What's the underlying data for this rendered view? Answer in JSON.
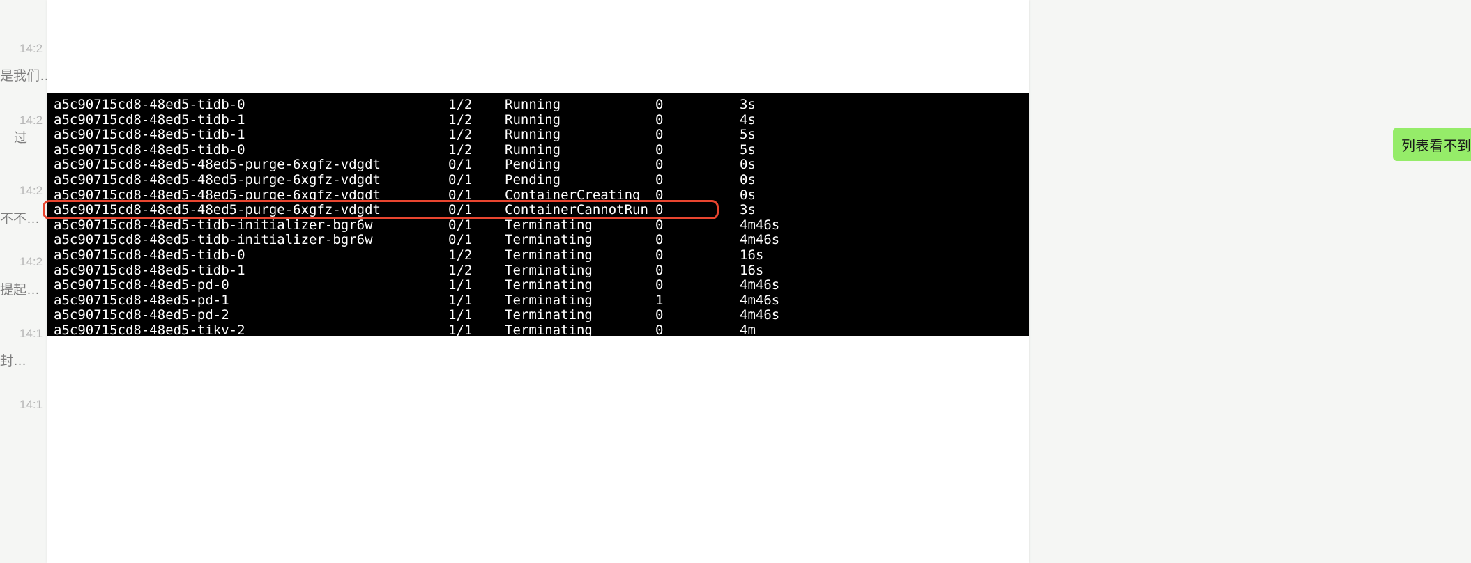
{
  "sidebar": {
    "items": [
      {
        "time": "14:2",
        "text": ""
      },
      {
        "time": "",
        "text": "是我们…"
      },
      {
        "time": "14:2",
        "text": "过"
      },
      {
        "time": "14:2",
        "text": ""
      },
      {
        "time": "",
        "text": "不不…"
      },
      {
        "time": "14:2",
        "text": ""
      },
      {
        "time": "",
        "text": "提起…"
      },
      {
        "time": "14:1",
        "text": ""
      },
      {
        "time": "",
        "text": "封…"
      },
      {
        "time": "14:1",
        "text": ""
      }
    ]
  },
  "terminal": {
    "rows": [
      {
        "name": "a5c90715cd8-48ed5-tidb-0",
        "ready": "1/2",
        "status": "Running",
        "restarts": "0",
        "age": "3s"
      },
      {
        "name": "a5c90715cd8-48ed5-tidb-1",
        "ready": "1/2",
        "status": "Running",
        "restarts": "0",
        "age": "4s"
      },
      {
        "name": "a5c90715cd8-48ed5-tidb-1",
        "ready": "1/2",
        "status": "Running",
        "restarts": "0",
        "age": "5s"
      },
      {
        "name": "a5c90715cd8-48ed5-tidb-0",
        "ready": "1/2",
        "status": "Running",
        "restarts": "0",
        "age": "5s"
      },
      {
        "name": "a5c90715cd8-48ed5-48ed5-purge-6xgfz-vdgdt",
        "ready": "0/1",
        "status": "Pending",
        "restarts": "0",
        "age": "0s"
      },
      {
        "name": "a5c90715cd8-48ed5-48ed5-purge-6xgfz-vdgdt",
        "ready": "0/1",
        "status": "Pending",
        "restarts": "0",
        "age": "0s"
      },
      {
        "name": "a5c90715cd8-48ed5-48ed5-purge-6xgfz-vdgdt",
        "ready": "0/1",
        "status": "ContainerCreating",
        "restarts": "0",
        "age": "0s"
      },
      {
        "name": "a5c90715cd8-48ed5-48ed5-purge-6xgfz-vdgdt",
        "ready": "0/1",
        "status": "ContainerCannotRun",
        "restarts": "0",
        "age": "3s"
      },
      {
        "name": "a5c90715cd8-48ed5-tidb-initializer-bgr6w",
        "ready": "0/1",
        "status": "Terminating",
        "restarts": "0",
        "age": "4m46s"
      },
      {
        "name": "a5c90715cd8-48ed5-tidb-initializer-bgr6w",
        "ready": "0/1",
        "status": "Terminating",
        "restarts": "0",
        "age": "4m46s"
      },
      {
        "name": "a5c90715cd8-48ed5-tidb-0",
        "ready": "1/2",
        "status": "Terminating",
        "restarts": "0",
        "age": "16s"
      },
      {
        "name": "a5c90715cd8-48ed5-tidb-1",
        "ready": "1/2",
        "status": "Terminating",
        "restarts": "0",
        "age": "16s"
      },
      {
        "name": "a5c90715cd8-48ed5-pd-0",
        "ready": "1/1",
        "status": "Terminating",
        "restarts": "0",
        "age": "4m46s"
      },
      {
        "name": "a5c90715cd8-48ed5-pd-1",
        "ready": "1/1",
        "status": "Terminating",
        "restarts": "1",
        "age": "4m46s"
      },
      {
        "name": "a5c90715cd8-48ed5-pd-2",
        "ready": "1/1",
        "status": "Terminating",
        "restarts": "0",
        "age": "4m46s"
      },
      {
        "name": "a5c90715cd8-48ed5-tikv-2",
        "ready": "1/1",
        "status": "Terminating",
        "restarts": "0",
        "age": "4m"
      }
    ],
    "highlight_row_index": 7
  },
  "bubble": {
    "text": "列表看不到"
  }
}
